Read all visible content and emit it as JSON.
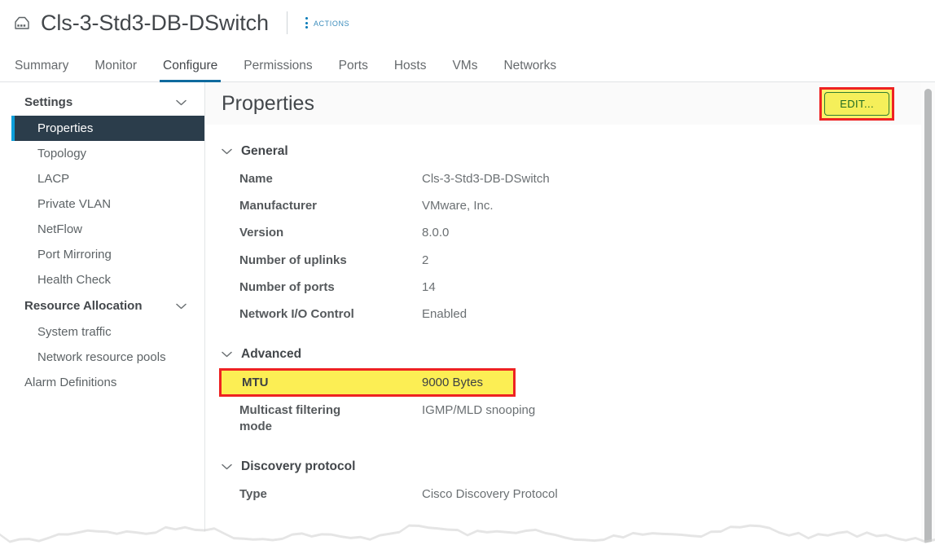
{
  "titlebar": {
    "icon": "distributed-switch-icon",
    "object_name": "Cls-3-Std3-DB-DSwitch",
    "actions_label": "Actions",
    "actions_icon": "kebab-menu-icon"
  },
  "tabs": [
    {
      "label": "Summary",
      "active": false
    },
    {
      "label": "Monitor",
      "active": false
    },
    {
      "label": "Configure",
      "active": true
    },
    {
      "label": "Permissions",
      "active": false
    },
    {
      "label": "Ports",
      "active": false
    },
    {
      "label": "Hosts",
      "active": false
    },
    {
      "label": "VMs",
      "active": false
    },
    {
      "label": "Networks",
      "active": false
    }
  ],
  "sidebar": {
    "groups": [
      {
        "label": "Settings",
        "chevron": "chevron-down-icon",
        "items": [
          {
            "label": "Properties",
            "selected": true
          },
          {
            "label": "Topology",
            "selected": false
          },
          {
            "label": "LACP",
            "selected": false
          },
          {
            "label": "Private VLAN",
            "selected": false
          },
          {
            "label": "NetFlow",
            "selected": false
          },
          {
            "label": "Port Mirroring",
            "selected": false
          },
          {
            "label": "Health Check",
            "selected": false
          }
        ]
      },
      {
        "label": "Resource Allocation",
        "chevron": "chevron-down-icon",
        "items": [
          {
            "label": "System traffic",
            "selected": false
          },
          {
            "label": "Network resource pools",
            "selected": false
          }
        ]
      }
    ],
    "standalone_items": [
      {
        "label": "Alarm Definitions",
        "selected": false
      }
    ]
  },
  "main": {
    "page_title": "Properties",
    "edit_button": "EDIT...",
    "sections": [
      {
        "title": "General",
        "chevron": "chevron-down-icon",
        "rows": [
          {
            "key": "Name",
            "value": "Cls-3-Std3-DB-DSwitch",
            "highlight": false
          },
          {
            "key": "Manufacturer",
            "value": "VMware, Inc.",
            "highlight": false
          },
          {
            "key": "Version",
            "value": "8.0.0",
            "highlight": false
          },
          {
            "key": "Number of uplinks",
            "value": "2",
            "highlight": false
          },
          {
            "key": "Number of ports",
            "value": "14",
            "highlight": false
          },
          {
            "key": "Network I/O Control",
            "value": "Enabled",
            "highlight": false
          }
        ]
      },
      {
        "title": "Advanced",
        "chevron": "chevron-down-icon",
        "rows": [
          {
            "key": "MTU",
            "value": "9000 Bytes",
            "highlight": true
          },
          {
            "key": "Multicast filtering\nmode",
            "value": "IGMP/MLD snooping",
            "highlight": false
          }
        ]
      },
      {
        "title": "Discovery protocol",
        "chevron": "chevron-down-icon",
        "rows": [
          {
            "key": "Type",
            "value": "Cisco Discovery Protocol",
            "highlight": false
          }
        ]
      }
    ]
  },
  "colors": {
    "accent_blue": "#0f6a9e",
    "actions_blue": "#3c8dbc",
    "selected_nav_bg": "#2b3d4b",
    "selected_nav_bar": "#0c9ed9",
    "highlight_yellow": "#fcee54",
    "annotation_red": "#ee2222",
    "edit_btn_border_green": "#2f7d32"
  },
  "scrollbar": {
    "orientation": "vertical",
    "position": "top"
  }
}
